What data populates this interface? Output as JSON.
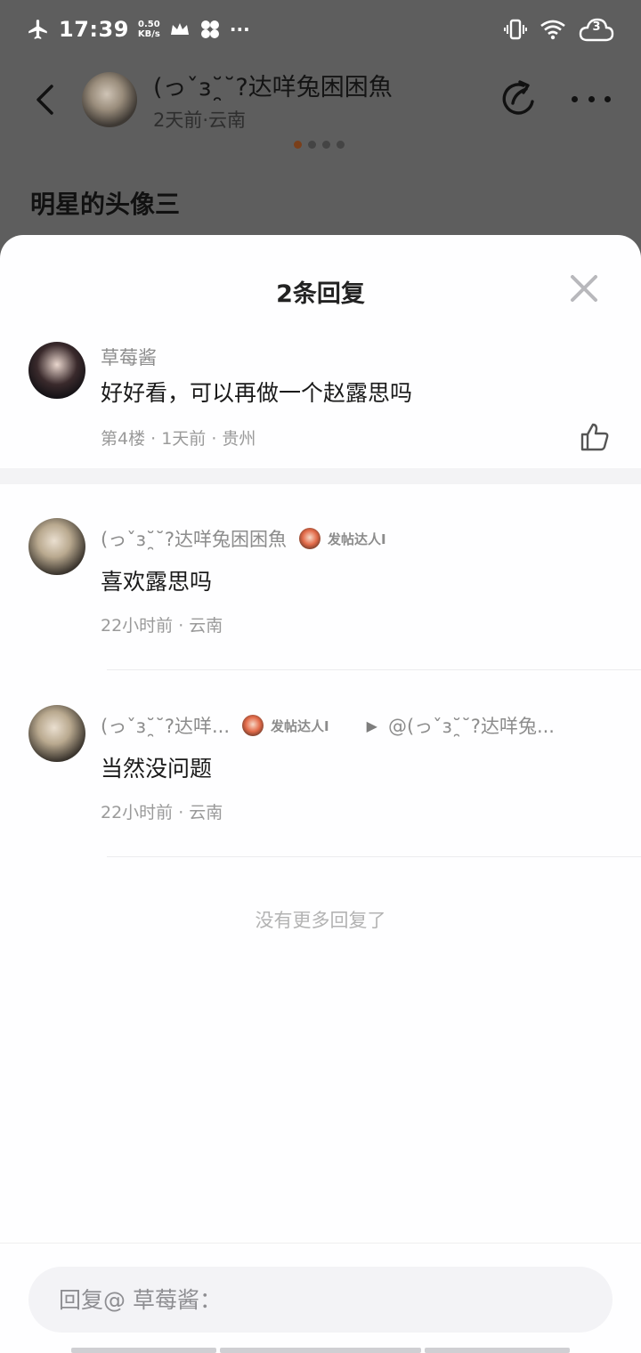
{
  "status_bar": {
    "time": "17:39",
    "net_speed_value": "0.50",
    "net_speed_unit": "KB/s",
    "more": "···",
    "cloud_count": "3"
  },
  "post": {
    "author_name": "(っˇɜ˘̯˘?达咩兔困困魚",
    "author_meta": "2天前·云南",
    "title": "明星的头像三"
  },
  "sheet": {
    "title": "2条回复",
    "root_comment": {
      "author": "草莓酱",
      "text": "好好看，可以再做一个赵露思吗",
      "meta": "第4楼 · 1天前 · 贵州"
    },
    "replies": [
      {
        "author": "(っˇɜ˘̯˘?达咩兔困困魚",
        "badge": "发帖达人I",
        "text": "喜欢露思吗",
        "meta": "22小时前 · 云南"
      },
      {
        "author": "(っˇɜ˘̯˘?达咩...",
        "badge": "发帖达人I",
        "reply_to": "@(っˇɜ˘̯˘?达咩兔...",
        "text": "当然没问题",
        "meta": "22小时前 · 云南"
      }
    ],
    "no_more": "没有更多回复了",
    "input_placeholder": "回复@ 草莓酱："
  },
  "colors": {
    "overlay": "#5e5e5e",
    "sheet_bg": "#fefeff",
    "muted_text": "#8c8c8c",
    "input_bg": "#f3f3f6"
  },
  "icons": [
    "airplane-icon",
    "crown-icon",
    "fan-icon",
    "vibrate-icon",
    "wifi-icon",
    "cloud-icon",
    "back-icon",
    "share-icon",
    "more-icon",
    "close-icon",
    "thumbs-up-icon",
    "play-arrow-icon"
  ]
}
